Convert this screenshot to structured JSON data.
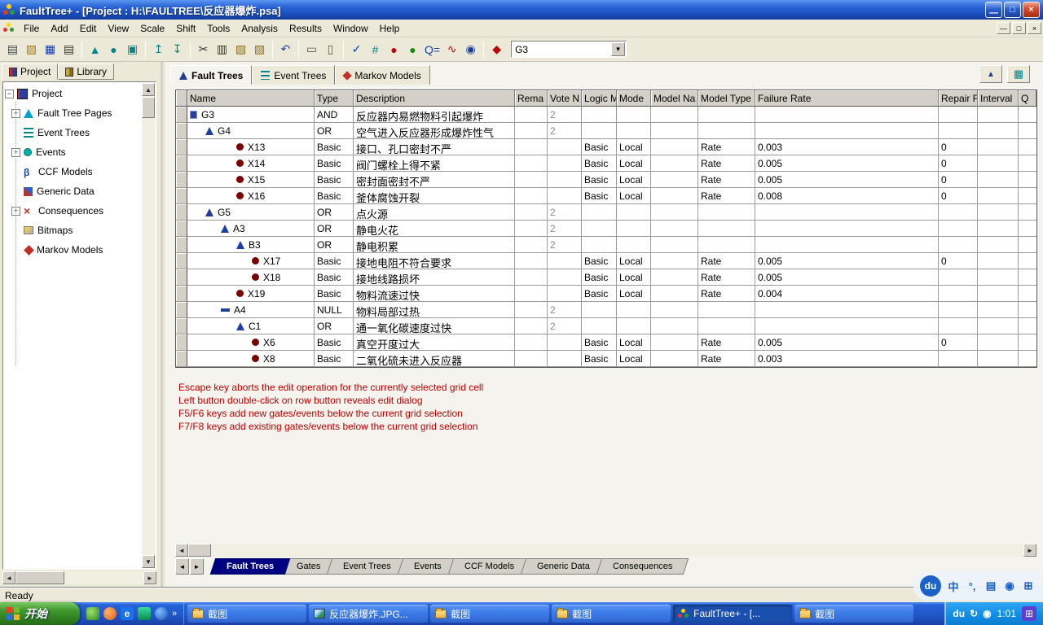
{
  "titlebar": {
    "title": "FaultTree+ - [Project : H:\\FAULTREE\\反应器爆炸.psa]",
    "minimize": "—",
    "restore": "□",
    "close": "×"
  },
  "menubar": {
    "items": [
      "File",
      "Add",
      "Edit",
      "View",
      "Scale",
      "Shift",
      "Tools",
      "Analysis",
      "Results",
      "Window",
      "Help"
    ],
    "mdi_minimize": "—",
    "mdi_restore": "□",
    "mdi_close": "×"
  },
  "toolbar": {
    "combo_value": "G3",
    "icons": [
      {
        "name": "new-document-icon",
        "glyph": "▤",
        "color": "#444444"
      },
      {
        "name": "open-folder-icon",
        "glyph": "▨",
        "color": "#a8760b"
      },
      {
        "name": "save-icon",
        "glyph": "▦",
        "color": "#1f3f9f"
      },
      {
        "name": "print-icon",
        "glyph": "▤",
        "color": "#333333",
        "sep": true
      },
      {
        "name": "add-gate-icon",
        "glyph": "▲",
        "color": "#00868b"
      },
      {
        "name": "add-event-icon",
        "glyph": "●",
        "color": "#00868b"
      },
      {
        "name": "add-page-icon",
        "glyph": "▣",
        "color": "#00868b",
        "sep": true
      },
      {
        "name": "move-up-icon",
        "glyph": "↥",
        "color": "#00868b"
      },
      {
        "name": "move-down-icon",
        "glyph": "↧",
        "color": "#00868b",
        "sep": true
      },
      {
        "name": "cut-icon",
        "glyph": "✂",
        "color": "#333333"
      },
      {
        "name": "copy-icon",
        "glyph": "▥",
        "color": "#333333"
      },
      {
        "name": "paste-icon",
        "glyph": "▧",
        "color": "#8a6d1f"
      },
      {
        "name": "paste-special-icon",
        "glyph": "▨",
        "color": "#8a6d1f",
        "sep": true
      },
      {
        "name": "undo-icon",
        "glyph": "↶",
        "color": "#1f3f9f",
        "sep": true
      },
      {
        "name": "insert-row-icon",
        "glyph": "▭",
        "color": "#555555"
      },
      {
        "name": "insert-col-icon",
        "glyph": "▯",
        "color": "#555555",
        "sep": true
      },
      {
        "name": "verify-icon",
        "glyph": "✓",
        "color": "#0040c0"
      },
      {
        "name": "number-grid-icon",
        "glyph": "#",
        "color": "#00868b"
      },
      {
        "name": "traffic-light-red-icon",
        "glyph": "●",
        "color": "#c00000"
      },
      {
        "name": "traffic-light-green-icon",
        "glyph": "●",
        "color": "#1a8a1a"
      },
      {
        "name": "q-check-icon",
        "glyph": "Q=",
        "color": "#1f3f9f"
      },
      {
        "name": "trend-icon",
        "glyph": "∿",
        "color": "#c00000"
      },
      {
        "name": "globe-icon",
        "glyph": "◉",
        "color": "#1f3f9f",
        "sep": true
      },
      {
        "name": "markov-icon",
        "glyph": "◆",
        "color": "#c00000"
      }
    ]
  },
  "left_panel": {
    "tabs": [
      {
        "label": "Project"
      },
      {
        "label": "Library"
      }
    ],
    "tree": [
      {
        "label": "Project"
      },
      {
        "label": "Fault Tree Pages"
      },
      {
        "label": "Event Trees"
      },
      {
        "label": "Events"
      },
      {
        "label": "CCF Models"
      },
      {
        "label": "Generic Data"
      },
      {
        "label": "Consequences"
      },
      {
        "label": "Bitmaps"
      },
      {
        "label": "Markov Models"
      }
    ]
  },
  "doc_tabs": [
    {
      "label": "Fault Trees"
    },
    {
      "label": "Event Trees"
    },
    {
      "label": "Markov Models"
    }
  ],
  "grid": {
    "columns": [
      {
        "key": "name",
        "label": "Name"
      },
      {
        "key": "type",
        "label": "Type"
      },
      {
        "key": "description",
        "label": "Description"
      },
      {
        "key": "remarks",
        "label": "Rema"
      },
      {
        "key": "vote",
        "label": "Vote N"
      },
      {
        "key": "logic",
        "label": "Logic M"
      },
      {
        "key": "mode",
        "label": "Mode"
      },
      {
        "key": "model-name",
        "label": "Model Na"
      },
      {
        "key": "model-type",
        "label": "Model Type"
      },
      {
        "key": "failure-rate",
        "label": "Failure Rate"
      },
      {
        "key": "repair",
        "label": "Repair F"
      },
      {
        "key": "interval",
        "label": "Interval"
      },
      {
        "key": "q",
        "label": "Q"
      }
    ],
    "rows": [
      {
        "name": "G3",
        "icon": "top-gate",
        "level": 0,
        "type": "AND",
        "desc": "反应器内易燃物料引起爆炸",
        "vote": "2"
      },
      {
        "name": "G4",
        "icon": "gate",
        "level": 1,
        "type": "OR",
        "desc": "空气进入反应器形成爆炸性气",
        "vote": "2"
      },
      {
        "name": "X13",
        "icon": "event",
        "level": 3,
        "type": "Basic",
        "desc": "接口、孔口密封不严",
        "logic": "Basic",
        "mode": "Local",
        "model_type": "Rate",
        "failure_rate": "0.003",
        "repair": "0"
      },
      {
        "name": "X14",
        "icon": "event",
        "level": 3,
        "type": "Basic",
        "desc": "阀门螺栓上得不紧",
        "logic": "Basic",
        "mode": "Local",
        "model_type": "Rate",
        "failure_rate": "0.005",
        "repair": "0"
      },
      {
        "name": "X15",
        "icon": "event",
        "level": 3,
        "type": "Basic",
        "desc": "密封面密封不严",
        "logic": "Basic",
        "mode": "Local",
        "model_type": "Rate",
        "failure_rate": "0.005",
        "repair": "0"
      },
      {
        "name": "X16",
        "icon": "event",
        "level": 3,
        "type": "Basic",
        "desc": "釜体腐蚀开裂",
        "logic": "Basic",
        "mode": "Local",
        "model_type": "Rate",
        "failure_rate": "0.008",
        "repair": "0"
      },
      {
        "name": "G5",
        "icon": "gate",
        "level": 1,
        "type": "OR",
        "desc": "点火源",
        "vote": "2"
      },
      {
        "name": "A3",
        "icon": "gate",
        "level": 2,
        "type": "OR",
        "desc": "静电火花",
        "vote": "2"
      },
      {
        "name": "B3",
        "icon": "gate",
        "level": 3,
        "type": "OR",
        "desc": "静电积累",
        "vote": "2"
      },
      {
        "name": "X17",
        "icon": "event",
        "level": 4,
        "type": "Basic",
        "desc": "接地电阻不符合要求",
        "logic": "Basic",
        "mode": "Local",
        "model_type": "Rate",
        "failure_rate": "0.005",
        "repair": "0"
      },
      {
        "name": "X18",
        "icon": "event",
        "level": 4,
        "type": "Basic",
        "desc": "接地线路损坏",
        "logic": "Basic",
        "mode": "Local",
        "model_type": "Rate",
        "failure_rate": "0.005",
        "repair": ""
      },
      {
        "name": "X19",
        "icon": "event",
        "level": 3,
        "type": "Basic",
        "desc": "物料流速过快",
        "logic": "Basic",
        "mode": "Local",
        "model_type": "Rate",
        "failure_rate": "0.004",
        "repair": ""
      },
      {
        "name": "A4",
        "icon": "null-gate",
        "level": 2,
        "type": "NULL",
        "desc": "物料局部过热",
        "vote": "2"
      },
      {
        "name": "C1",
        "icon": "gate",
        "level": 3,
        "type": "OR",
        "desc": "通一氧化碳速度过快",
        "vote": "2"
      },
      {
        "name": "X6",
        "icon": "event",
        "level": 4,
        "type": "Basic",
        "desc": "真空开度过大",
        "logic": "Basic",
        "mode": "Local",
        "model_type": "Rate",
        "failure_rate": "0.005",
        "repair": "0"
      },
      {
        "name": "X8",
        "icon": "event",
        "level": 4,
        "type": "Basic",
        "desc": "二氧化硫未进入反应器",
        "logic": "Basic",
        "mode": "Local",
        "model_type": "Rate",
        "failure_rate": "0.003",
        "repair": ""
      }
    ]
  },
  "help_lines": [
    "Escape key aborts the edit operation for the currently selected grid cell",
    "Left button double-click on row button reveals edit dialog",
    "F5/F6 keys add new gates/events below the current grid selection",
    "F7/F8 keys add existing gates/events below the current grid selection"
  ],
  "sheet_tabs": {
    "items": [
      "Fault Trees",
      "Gates",
      "Event Trees",
      "Events",
      "CCF Models",
      "Generic Data",
      "Consequences"
    ],
    "active_index": 0
  },
  "statusbar": {
    "text": "Ready"
  },
  "ime": {
    "logo": "du",
    "items": [
      {
        "name": "ime-mode-icon",
        "glyph": "中"
      },
      {
        "name": "ime-punctuation-icon",
        "glyph": "°,"
      },
      {
        "name": "ime-keyboard-icon",
        "glyph": "▤"
      },
      {
        "name": "ime-user-icon",
        "glyph": "◉"
      },
      {
        "name": "ime-menu-icon",
        "glyph": "⊞"
      }
    ]
  },
  "taskbar": {
    "start_label": "开始",
    "buttons": [
      {
        "label": "截图",
        "icon": "folder"
      },
      {
        "label": "反应器爆炸.JPG...",
        "icon": "image"
      },
      {
        "label": "截图",
        "icon": "folder"
      },
      {
        "label": "截图",
        "icon": "folder"
      },
      {
        "label": "FaultTree+ - [...",
        "icon": "app",
        "active": true
      },
      {
        "label": "截图",
        "icon": "folder"
      }
    ],
    "tray_icons": [
      {
        "name": "tray-ime-du-badge",
        "glyph": "du"
      },
      {
        "name": "tray-sync-icon",
        "glyph": "↻"
      },
      {
        "name": "tray-shield-icon",
        "glyph": "◉"
      }
    ],
    "time": "1:01"
  },
  "colors": {
    "titlebar_blue": "#2a64d8",
    "taskbar_blue": "#2158c8",
    "start_green": "#3f9a2f",
    "active_sheet_tab": "#000080",
    "help_text_red": "#c00000",
    "gate_blue": "#1f3f9f",
    "event_red": "#7b0000",
    "tray_blue": "#1290e8"
  }
}
